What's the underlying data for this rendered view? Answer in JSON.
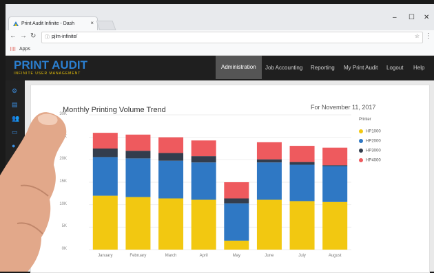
{
  "browser": {
    "tab_title": "Print Audit Infinite - Dash",
    "tab_close": "×",
    "url": "pjlm-infinite/",
    "bookmark_label": "Apps"
  },
  "app": {
    "logo_print": "PRINT",
    "logo_audit": "AUDIT",
    "logo_sub": "INFINITE USER MANAGEMENT",
    "nav": [
      {
        "label": "Administration",
        "active": true
      },
      {
        "label": "Job Accounting"
      },
      {
        "label": "Reporting"
      },
      {
        "label": "My Print Audit"
      },
      {
        "label": "Logout"
      },
      {
        "label": "Help"
      }
    ]
  },
  "card": {
    "title": "Monthly Printing Volume Trend",
    "date": "For November 11, 2017"
  },
  "chart_data": {
    "type": "bar",
    "stacked": true,
    "title": "Monthly Printing Volume Trend",
    "categories": [
      "January",
      "February",
      "March",
      "April",
      "May",
      "June",
      "July",
      "August"
    ],
    "ylim": [
      0,
      30000
    ],
    "yticks": [
      "0K",
      "5K",
      "10K",
      "15K",
      "20K",
      "25K",
      "30K"
    ],
    "legend_title": "Printer",
    "legend_position": "right",
    "series": [
      {
        "name": "HP1000",
        "color": "#f2c811",
        "values": [
          12000,
          11700,
          11400,
          11100,
          2000,
          11100,
          10800,
          10600
        ]
      },
      {
        "name": "HP2000",
        "color": "#2f78c4",
        "values": [
          8600,
          8600,
          8400,
          8300,
          8300,
          8300,
          8100,
          8000
        ]
      },
      {
        "name": "HP3000",
        "color": "#333d4d",
        "values": [
          1900,
          1700,
          1700,
          1400,
          1100,
          700,
          600,
          200
        ]
      },
      {
        "name": "HP4000",
        "color": "#ee5a5e",
        "values": [
          3500,
          3600,
          3500,
          3500,
          3600,
          3800,
          3600,
          3900
        ]
      }
    ]
  }
}
